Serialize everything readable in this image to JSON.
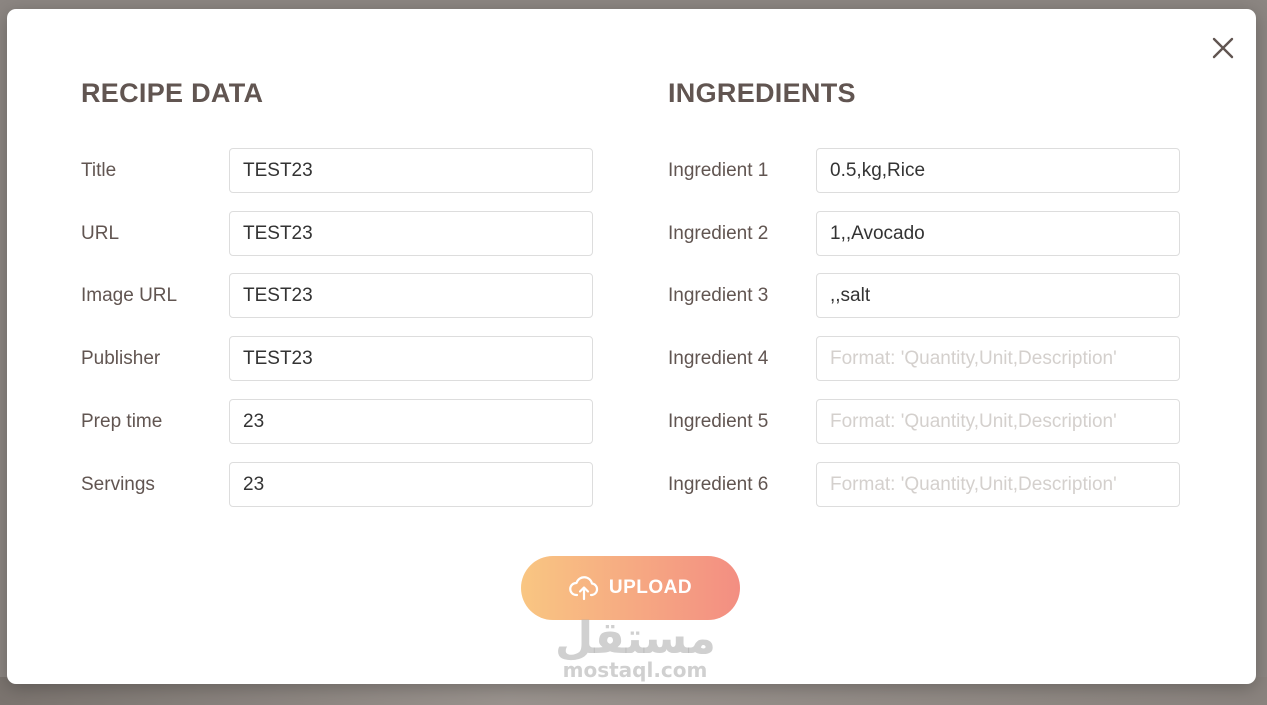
{
  "recipe": {
    "heading": "RECIPE DATA",
    "fields": [
      {
        "label": "Title",
        "value": "TEST23",
        "placeholder": ""
      },
      {
        "label": "URL",
        "value": "TEST23",
        "placeholder": ""
      },
      {
        "label": "Image URL",
        "value": "TEST23",
        "placeholder": ""
      },
      {
        "label": "Publisher",
        "value": "TEST23",
        "placeholder": ""
      },
      {
        "label": "Prep time",
        "value": "23",
        "placeholder": ""
      },
      {
        "label": "Servings",
        "value": "23",
        "placeholder": ""
      }
    ]
  },
  "ingredients": {
    "heading": "INGREDIENTS",
    "fields": [
      {
        "label": "Ingredient 1",
        "value": "0.5,kg,Rice",
        "placeholder": "Format: 'Quantity,Unit,Description'"
      },
      {
        "label": "Ingredient 2",
        "value": "1,,Avocado",
        "placeholder": "Format: 'Quantity,Unit,Description'"
      },
      {
        "label": "Ingredient 3",
        "value": ",,salt",
        "placeholder": "Format: 'Quantity,Unit,Description'"
      },
      {
        "label": "Ingredient 4",
        "value": "",
        "placeholder": "Format: 'Quantity,Unit,Description'"
      },
      {
        "label": "Ingredient 5",
        "value": "",
        "placeholder": "Format: 'Quantity,Unit,Description'"
      },
      {
        "label": "Ingredient 6",
        "value": "",
        "placeholder": "Format: 'Quantity,Unit,Description'"
      }
    ]
  },
  "upload": {
    "label": "UPLOAD",
    "icon": "cloud-upload-icon"
  },
  "close": {
    "icon": "close-icon"
  },
  "watermark": {
    "arabic": "مستقل",
    "latin": "mostaql.com"
  },
  "colors": {
    "heading": "#615551",
    "accent_start": "#f9c682",
    "accent_end": "#f38e82"
  }
}
